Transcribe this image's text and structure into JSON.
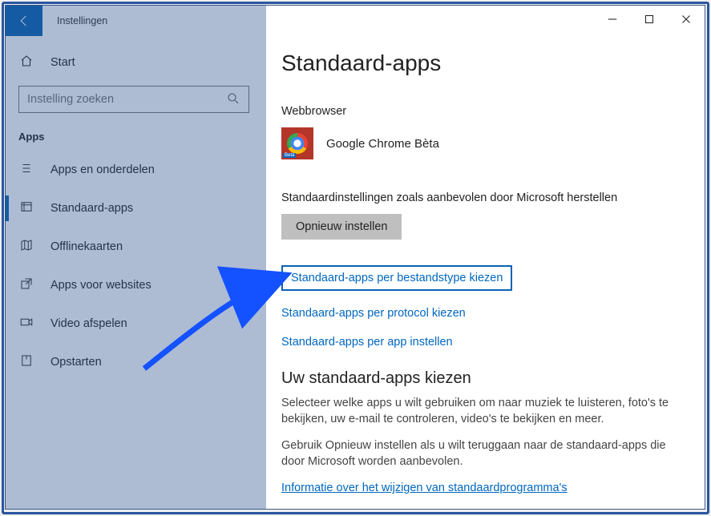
{
  "titlebar": {
    "app_name": "Instellingen"
  },
  "sidebar": {
    "home_label": "Start",
    "search_placeholder": "Instelling zoeken",
    "section_label": "Apps",
    "items": [
      {
        "label": "Apps en onderdelen",
        "icon": "list-icon",
        "active": false
      },
      {
        "label": "Standaard-apps",
        "icon": "defaults-icon",
        "active": true
      },
      {
        "label": "Offlinekaarten",
        "icon": "map-icon",
        "active": false
      },
      {
        "label": "Apps voor websites",
        "icon": "share-icon",
        "active": false
      },
      {
        "label": "Video afspelen",
        "icon": "video-icon",
        "active": false
      },
      {
        "label": "Opstarten",
        "icon": "startup-icon",
        "active": false
      }
    ]
  },
  "content": {
    "page_title": "Standaard-apps",
    "webbrowser_label": "Webbrowser",
    "browser_name": "Google Chrome Bèta",
    "reset_label": "Standaardinstellingen zoals aanbevolen door Microsoft herstellen",
    "reset_button": "Opnieuw instellen",
    "links": {
      "by_filetype": "Standaard-apps per bestandstype kiezen",
      "by_protocol": "Standaard-apps per protocol kiezen",
      "by_app": "Standaard-apps per app instellen"
    },
    "help": {
      "title": "Uw standaard-apps kiezen",
      "para1": "Selecteer welke apps u wilt gebruiken om naar muziek te luisteren, foto's te bekijken, uw e-mail te controleren, video's te bekijken en meer.",
      "para2": "Gebruik Opnieuw instellen als u wilt teruggaan naar de standaard-apps die door Microsoft worden aanbevolen.",
      "more_link": "Informatie over het wijzigen van standaardprogramma's"
    }
  },
  "annotation": {
    "highlighted_link": "by_filetype"
  }
}
